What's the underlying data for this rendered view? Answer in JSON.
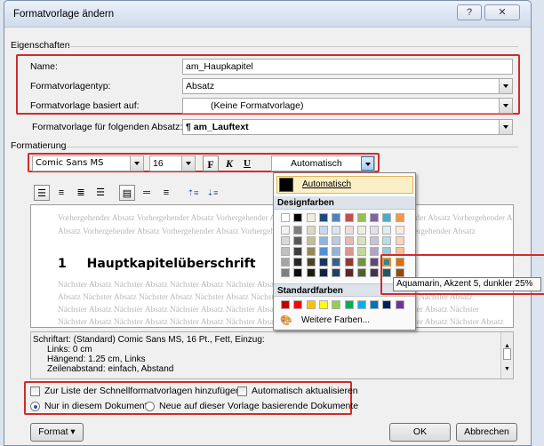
{
  "window": {
    "title": "Formatvorlage ändern",
    "help_label": "?",
    "close_label": "✕"
  },
  "properties": {
    "group_label": "Eigenschaften",
    "name_label": "Name:",
    "name_value": "am_Haupkapitel",
    "type_label": "Formatvorlagentyp:",
    "type_value": "Absatz",
    "based_on_label": "Formatvorlage basiert auf:",
    "based_on_value": "(Keine Formatvorlage)",
    "next_label": "Formatvorlage für folgenden Absatz:",
    "next_value": "¶ am_Lauftext"
  },
  "formatting": {
    "group_label": "Formatierung",
    "font": "Comic Sans MS",
    "size": "16",
    "bold_label": "F",
    "italic_label": "K",
    "underline_label": "U",
    "color_value": "Automatisch"
  },
  "preview": {
    "prev_line1": "Vorhergehender Absatz Vorhergehender Absatz Vorhergehender Absatz Vorhergehender Absatz Vorhergehender Absatz Vorhergehender Absatz",
    "prev_line2": "Absatz Vorhergehender Absatz Vorhergehender Absatz Vorhergehender Absatz Vorhergehender Absatz Vorhergehender Absatz",
    "heading_number": "1",
    "heading_text": "Hauptkapitelüberschrift",
    "next_lines": [
      "Nächster Absatz Nächster Absatz Nächster Absatz Nächster Absatz Nächster Absatz Nächster Absatz Nächster Absatz Nächster Absatz",
      "Absatz Nächster Absatz Nächster Absatz Nächster Absatz Nächster Absatz Nächster Absatz Nächster Absatz Nächster Absatz",
      "Nächster Absatz Nächster Absatz Nächster Absatz Nächster Absatz Nächster Absatz Nächster Absatz Nächster Absatz Nächster",
      "Nächster Absatz Nächster Absatz Nächster Absatz Nächster Absatz Nächster Absatz Nächster Absatz Nächster Absatz Nächster Absatz"
    ]
  },
  "description": {
    "lines": [
      "Schriftart: (Standard) Comic Sans MS, 16 Pt., Fett, Einzug:",
      "Links:  0 cm",
      "Hängend:  1.25 cm, Links",
      "Zeilenabstand:  einfach, Abstand"
    ]
  },
  "options": {
    "add_to_quick": "Zur Liste der Schnellformatvorlagen hinzufügen",
    "auto_update": "Automatisch aktualisieren",
    "only_doc": "Nur in diesem Dokument",
    "new_docs": "Neue auf dieser Vorlage basierende Dokumente"
  },
  "buttons": {
    "format": "Format ▾",
    "ok": "OK",
    "cancel": "Abbrechen"
  },
  "color_popup": {
    "automatic_label": "Automatisch",
    "design_label": "Designfarben",
    "standard_label": "Standardfarben",
    "more_colors_label": "Weitere Farben...",
    "tooltip": "Aquamarin, Akzent 5, dunkler 25%",
    "theme_colors": [
      [
        "#ffffff",
        "#000000",
        "#eeece1",
        "#1f497d",
        "#4f81bd",
        "#c0504d",
        "#9bbb59",
        "#8064a2",
        "#4bacc6",
        "#f79646"
      ],
      [
        "#f2f2f2",
        "#7f7f7f",
        "#ddd9c3",
        "#c6d9f0",
        "#dbe5f1",
        "#f2dcdb",
        "#ebf1dd",
        "#e5e0ec",
        "#dbeef3",
        "#fdeada"
      ],
      [
        "#d8d8d8",
        "#595959",
        "#c4bd97",
        "#8db3e2",
        "#b8cce4",
        "#e5b9b7",
        "#d7e3bc",
        "#ccc1d9",
        "#b7dde8",
        "#fbd5b5"
      ],
      [
        "#bfbfbf",
        "#3f3f3f",
        "#938953",
        "#548dd4",
        "#95b3d7",
        "#d99694",
        "#c3d69b",
        "#b2a2c7",
        "#92cddc",
        "#fac08f"
      ],
      [
        "#a5a5a5",
        "#262626",
        "#494429",
        "#17365d",
        "#366092",
        "#953734",
        "#76923c",
        "#5f497a",
        "#31859b",
        "#e36c09"
      ],
      [
        "#7f7f7f",
        "#0c0c0c",
        "#1d1b10",
        "#0f243e",
        "#244061",
        "#632423",
        "#4f6128",
        "#3f3151",
        "#205867",
        "#974806"
      ]
    ],
    "standard_colors": [
      "#c00000",
      "#ff0000",
      "#ffc000",
      "#ffff00",
      "#92d050",
      "#00b050",
      "#00b0f0",
      "#0070c0",
      "#002060",
      "#7030a0"
    ]
  }
}
